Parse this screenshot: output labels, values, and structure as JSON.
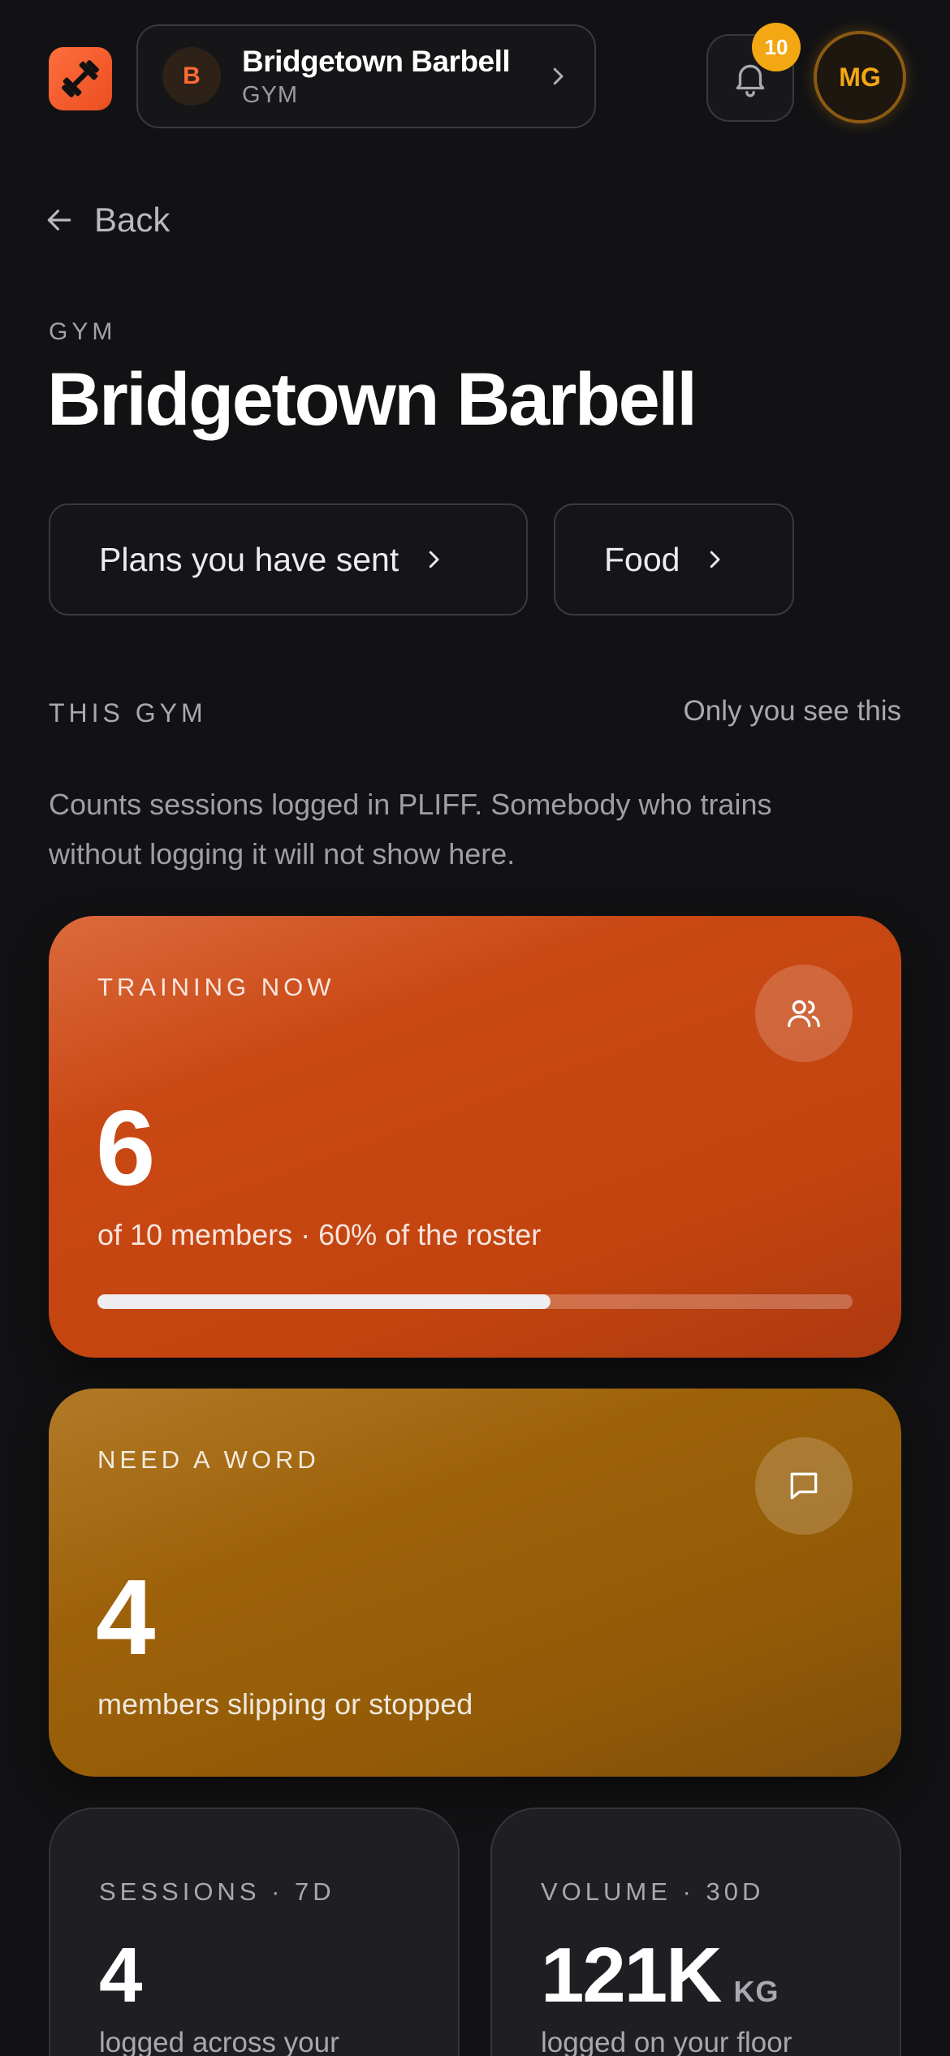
{
  "header": {
    "gym_initial": "B",
    "gym_name": "Bridgetown Barbell",
    "gym_type": "GYM",
    "notification_count": "10",
    "user_initials": "MG"
  },
  "back": {
    "label": "Back"
  },
  "title_block": {
    "eyebrow": "GYM",
    "title": "Bridgetown Barbell"
  },
  "actions": {
    "plans_label": "Plans you have sent",
    "food_label": "Food"
  },
  "section": {
    "label": "THIS GYM",
    "note": "Only you see this",
    "description": "Counts sessions logged in PLIFF. Somebody who trains without logging it will not show here."
  },
  "training_now": {
    "label": "TRAINING NOW",
    "value": "6",
    "subtitle": "of 10 members · 60% of the roster",
    "progress_fraction": 0.6,
    "icon": "users-icon"
  },
  "need_a_word": {
    "label": "NEED A WORD",
    "value": "4",
    "subtitle": "members slipping or stopped",
    "icon": "chat-icon"
  },
  "stats": {
    "sessions": {
      "label": "SESSIONS · 7D",
      "value": "4",
      "subtitle": "logged across your"
    },
    "volume": {
      "label": "VOLUME · 30D",
      "value": "121K",
      "unit": "KG",
      "subtitle": "logged on your floor"
    }
  },
  "colors": {
    "accent_orange": "#c94814",
    "accent_amber": "#9d6209",
    "badge": "#f3a712",
    "background": "#121214"
  }
}
